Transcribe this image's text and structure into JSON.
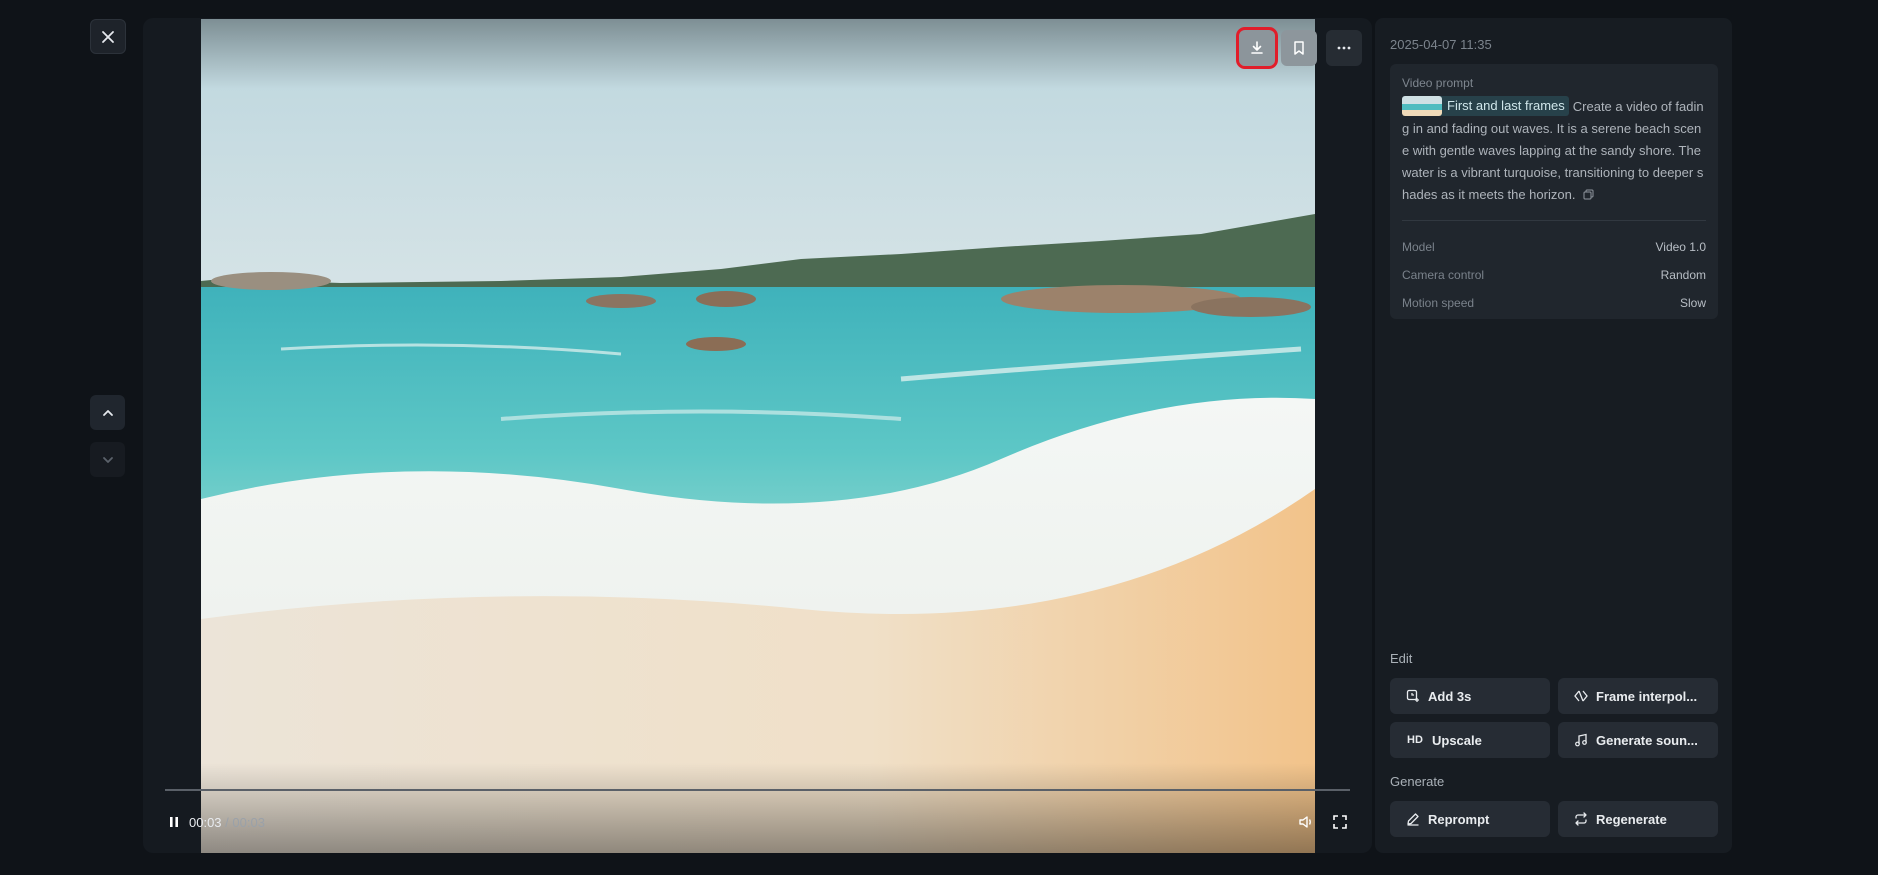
{
  "player": {
    "current_time": "00:03",
    "separator": " / ",
    "duration": "00:03",
    "progress": 1.0
  },
  "toolbar": {
    "download_icon": "download-icon",
    "bookmark_icon": "bookmark-icon",
    "more_icon": "more-horizontal-icon"
  },
  "panel": {
    "date": "2025-04-07 11:35",
    "prompt_label": "Video prompt",
    "tag_label": "First and last frames",
    "prompt_text": "Create a video of fading in and fading out waves. It is a serene beach scene with gentle waves lapping at the sandy shore. The water is a vibrant turquoise, transitioning to deeper shades as it meets the horizon.",
    "details": [
      {
        "key": "Model",
        "value": "Video 1.0"
      },
      {
        "key": "Camera control",
        "value": "Random"
      },
      {
        "key": "Motion speed",
        "value": "Slow"
      }
    ],
    "edit_label": "Edit",
    "edit_actions": [
      "Add 3s",
      "Frame interpol...",
      "Upscale",
      "Generate soun..."
    ],
    "generate_label": "Generate",
    "generate_actions": [
      "Reprompt",
      "Regenerate"
    ]
  },
  "colors": {
    "background": "#0f1318",
    "panel": "#171c22",
    "highlight": "#e11d2a",
    "tag_bg": "#27414a"
  }
}
